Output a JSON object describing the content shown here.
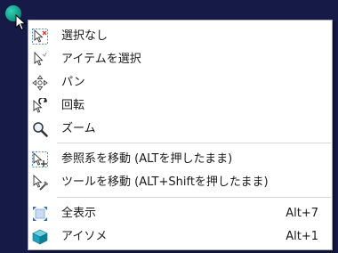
{
  "cursor": {
    "ball_icon": "sphere-cursor-icon",
    "arrow_icon": "pointer-arrow-icon"
  },
  "menu": {
    "items": [
      {
        "label": "選択なし",
        "icon": "select-none-cursor-icon"
      },
      {
        "label": "アイテムを選択",
        "icon": "select-item-cursor-icon"
      },
      {
        "label": "パン",
        "icon": "pan-icon"
      },
      {
        "label": "回転",
        "icon": "rotate-icon"
      },
      {
        "label": "ズーム",
        "icon": "zoom-magnifier-icon"
      },
      {
        "label": "参照系を移動 (ALTを押したまま)",
        "icon": "move-reference-frame-icon"
      },
      {
        "label": "ツールを移動 (ALT+Shiftを押したまま)",
        "icon": "move-tool-icon"
      },
      {
        "label": "全表示",
        "icon": "view-all-icon",
        "shortcut": "Alt+7"
      },
      {
        "label": "アイソメ",
        "icon": "isometric-cube-icon",
        "shortcut": "Alt+1"
      }
    ]
  }
}
